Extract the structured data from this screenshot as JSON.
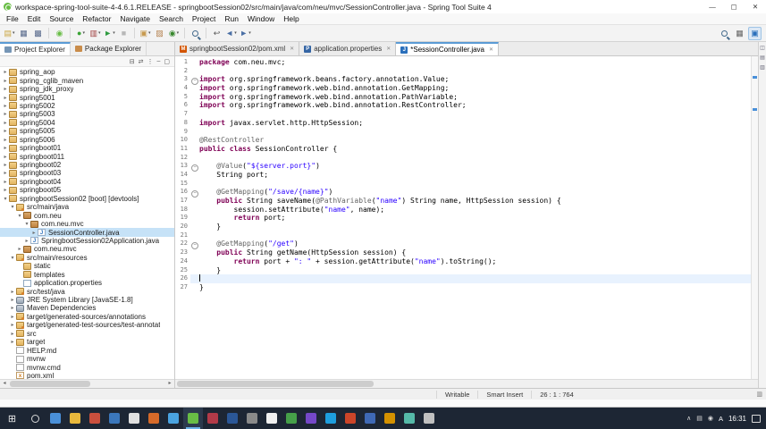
{
  "window": {
    "title": "workspace-spring-tool-suite-4-4.6.1.RELEASE - springbootSession02/src/main/java/com/neu/mvc/SessionController.java - Spring Tool Suite 4",
    "minimize": "—",
    "maximize": "▢",
    "close": "✕"
  },
  "menubar": [
    "File",
    "Edit",
    "Source",
    "Refactor",
    "Navigate",
    "Search",
    "Project",
    "Run",
    "Window",
    "Help"
  ],
  "toolbar": [
    {
      "name": "new-wizard",
      "glyph": "▤",
      "color": "#caa53f",
      "dd": true
    },
    {
      "name": "save",
      "glyph": "▦",
      "color": "#55678a"
    },
    {
      "name": "save-all",
      "glyph": "▩",
      "color": "#55678a"
    },
    {
      "sep": true
    },
    {
      "name": "boot-dashboard",
      "glyph": "◉",
      "color": "#68bd45"
    },
    {
      "sep": true
    },
    {
      "name": "debug",
      "glyph": "●",
      "color": "#3aa335",
      "dd": true
    },
    {
      "name": "coverage",
      "glyph": "▥",
      "color": "#9e3b3b",
      "dd": true
    },
    {
      "name": "run",
      "glyph": "►",
      "color": "#2e9b3f",
      "dd": true
    },
    {
      "name": "stop",
      "glyph": "■",
      "color": "#b8b8b8"
    },
    {
      "sep": true
    },
    {
      "name": "new-java-project",
      "glyph": "▣",
      "color": "#c79a4e",
      "dd": true
    },
    {
      "name": "new-package",
      "glyph": "▨",
      "color": "#b5824f"
    },
    {
      "name": "new-class",
      "glyph": "◉",
      "color": "#37872d",
      "dd": true
    },
    {
      "sep": true
    },
    {
      "name": "search",
      "lens": true
    },
    {
      "sep": true
    },
    {
      "name": "last-edit-location",
      "glyph": "↩",
      "color": "#555555"
    },
    {
      "name": "back",
      "glyph": "◄",
      "color": "#4a6fa5",
      "dd": true
    },
    {
      "name": "forward",
      "glyph": "►",
      "color": "#4a6fa5",
      "dd": true
    }
  ],
  "toolbar_right": [
    {
      "name": "quick-access-search",
      "lens": true
    },
    {
      "name": "open-perspective",
      "glyph": "▦",
      "color": "#666666"
    },
    {
      "name": "java-perspective",
      "glyph": "▣",
      "color": "#2a6fbb",
      "active": true
    }
  ],
  "explorer": {
    "tab_project": "Project Explorer",
    "tab_package": "Package Explorer",
    "toolbar": [
      {
        "name": "collapse-all",
        "glyph": "⊟"
      },
      {
        "name": "link-with-editor",
        "glyph": "⇄"
      },
      {
        "name": "view-menu",
        "glyph": "⋮"
      },
      {
        "name": "minimize-view",
        "glyph": "–"
      },
      {
        "name": "maximize-view",
        "glyph": "▢"
      }
    ],
    "tree": [
      {
        "label": "spring_aop",
        "level": 0,
        "icon": "project",
        "state": "c"
      },
      {
        "label": "spring_cglib_maven",
        "level": 0,
        "icon": "project",
        "state": "c"
      },
      {
        "label": "spring_jdk_proxy",
        "level": 0,
        "icon": "project",
        "state": "c"
      },
      {
        "label": "spring5001",
        "level": 0,
        "icon": "project",
        "state": "c"
      },
      {
        "label": "spring5002",
        "level": 0,
        "icon": "project",
        "state": "c"
      },
      {
        "label": "spring5003",
        "level": 0,
        "icon": "project",
        "state": "c"
      },
      {
        "label": "spring5004",
        "level": 0,
        "icon": "project",
        "state": "c"
      },
      {
        "label": "spring5005",
        "level": 0,
        "icon": "project",
        "state": "c"
      },
      {
        "label": "spring5006",
        "level": 0,
        "icon": "project",
        "state": "c"
      },
      {
        "label": "springboot01",
        "level": 0,
        "icon": "project",
        "state": "c"
      },
      {
        "label": "springboot011",
        "level": 0,
        "icon": "project",
        "state": "c"
      },
      {
        "label": "springboot02",
        "level": 0,
        "icon": "project",
        "state": "c"
      },
      {
        "label": "springboot03",
        "level": 0,
        "icon": "project",
        "state": "c"
      },
      {
        "label": "springboot04",
        "level": 0,
        "icon": "project",
        "state": "c"
      },
      {
        "label": "springboot05",
        "level": 0,
        "icon": "project",
        "state": "c"
      },
      {
        "label": "springbootSession02 [boot] [devtools]",
        "level": 0,
        "icon": "project",
        "state": "e"
      },
      {
        "label": "src/main/java",
        "level": 1,
        "icon": "srcfolder",
        "state": "e"
      },
      {
        "label": "com.neu",
        "level": 2,
        "icon": "package",
        "state": "e"
      },
      {
        "label": "com.neu.mvc",
        "level": 3,
        "icon": "package",
        "state": "e"
      },
      {
        "label": "SessionController.java",
        "level": 4,
        "icon": "java",
        "state": "c",
        "selected": true
      },
      {
        "label": "SpringbootSession02Application.java",
        "level": 3,
        "icon": "java",
        "state": "c"
      },
      {
        "label": "com.neu.mvc",
        "level": 2,
        "icon": "package",
        "state": "c"
      },
      {
        "label": "src/main/resources",
        "level": 1,
        "icon": "srcfolder",
        "state": "e"
      },
      {
        "label": "static",
        "level": 2,
        "icon": "folder",
        "state": "n"
      },
      {
        "label": "templates",
        "level": 2,
        "icon": "folder",
        "state": "n"
      },
      {
        "label": "application.properties",
        "level": 2,
        "icon": "props",
        "state": "n"
      },
      {
        "label": "src/test/java",
        "level": 1,
        "icon": "srcfolder",
        "state": "c"
      },
      {
        "label": "JRE System Library [JavaSE-1.8]",
        "level": 1,
        "icon": "lib",
        "state": "c"
      },
      {
        "label": "Maven Dependencies",
        "level": 1,
        "icon": "lib",
        "state": "c"
      },
      {
        "label": "target/generated-sources/annotations",
        "level": 1,
        "icon": "srcfolder",
        "state": "c"
      },
      {
        "label": "target/generated-test-sources/test-annotat",
        "level": 1,
        "icon": "srcfolder",
        "state": "c"
      },
      {
        "label": "src",
        "level": 1,
        "icon": "folder",
        "state": "c"
      },
      {
        "label": "target",
        "level": 1,
        "icon": "folder",
        "state": "c"
      },
      {
        "label": "HELP.md",
        "level": 1,
        "icon": "file",
        "state": "n"
      },
      {
        "label": "mvnw",
        "level": 1,
        "icon": "file",
        "state": "n"
      },
      {
        "label": "mvnw.cmd",
        "level": 1,
        "icon": "file",
        "state": "n"
      },
      {
        "label": "pom.xml",
        "level": 1,
        "icon": "xml",
        "state": "n"
      }
    ]
  },
  "editor": {
    "tabs": [
      {
        "label": "springbootSession02/pom.xml",
        "icon_letter": "M",
        "icon_color": "#d35400",
        "active": false
      },
      {
        "label": "application.properties",
        "icon_letter": "P",
        "icon_color": "#3465a4",
        "active": false
      },
      {
        "label": "*SessionController.java",
        "icon_letter": "J",
        "icon_color": "#2a6fbb",
        "active": true
      }
    ],
    "code": {
      "current_line": 26,
      "folds": [
        3,
        13,
        16,
        22
      ],
      "lines": [
        [
          [
            "k",
            "package"
          ],
          [
            "p",
            " com.neu.mvc;"
          ]
        ],
        [],
        [
          [
            "k",
            "import"
          ],
          [
            "p",
            " org.springframework.beans.factory.annotation.Value;"
          ]
        ],
        [
          [
            "k",
            "import"
          ],
          [
            "p",
            " org.springframework.web.bind.annotation.GetMapping;"
          ]
        ],
        [
          [
            "k",
            "import"
          ],
          [
            "p",
            " org.springframework.web.bind.annotation.PathVariable;"
          ]
        ],
        [
          [
            "k",
            "import"
          ],
          [
            "p",
            " org.springframework.web.bind.annotation.RestController;"
          ]
        ],
        [],
        [
          [
            "k",
            "import"
          ],
          [
            "p",
            " javax.servlet.http.HttpSession;"
          ]
        ],
        [],
        [
          [
            "a",
            "@RestController"
          ]
        ],
        [
          [
            "k",
            "public"
          ],
          [
            "p",
            " "
          ],
          [
            "k",
            "class"
          ],
          [
            "p",
            " SessionController {"
          ]
        ],
        [],
        [
          [
            "p",
            "    "
          ],
          [
            "a",
            "@Value"
          ],
          [
            "p",
            "("
          ],
          [
            "s",
            "\"${server.port}\""
          ],
          [
            "p",
            ")"
          ]
        ],
        [
          [
            "p",
            "    String port;"
          ]
        ],
        [],
        [
          [
            "p",
            "    "
          ],
          [
            "a",
            "@GetMapping"
          ],
          [
            "p",
            "("
          ],
          [
            "s",
            "\"/save/{name}\""
          ],
          [
            "p",
            ")"
          ]
        ],
        [
          [
            "p",
            "    "
          ],
          [
            "k",
            "public"
          ],
          [
            "p",
            " String saveName("
          ],
          [
            "a",
            "@PathVariable"
          ],
          [
            "p",
            "("
          ],
          [
            "s",
            "\"name\""
          ],
          [
            "p",
            ") String name, HttpSession session) {"
          ]
        ],
        [
          [
            "p",
            "        session.setAttribute("
          ],
          [
            "s",
            "\"name\""
          ],
          [
            "p",
            ", name);"
          ]
        ],
        [
          [
            "p",
            "        "
          ],
          [
            "k",
            "return"
          ],
          [
            "p",
            " port;"
          ]
        ],
        [
          [
            "p",
            "    }"
          ]
        ],
        [],
        [
          [
            "p",
            "    "
          ],
          [
            "a",
            "@GetMapping"
          ],
          [
            "p",
            "("
          ],
          [
            "s",
            "\"/get\""
          ],
          [
            "p",
            ")"
          ]
        ],
        [
          [
            "p",
            "    "
          ],
          [
            "k",
            "public"
          ],
          [
            "p",
            " String getName(HttpSession session) {"
          ]
        ],
        [
          [
            "p",
            "        "
          ],
          [
            "k",
            "return"
          ],
          [
            "p",
            " port + "
          ],
          [
            "s",
            "\": \""
          ],
          [
            "p",
            " + session.getAttribute("
          ],
          [
            "s",
            "\"name\""
          ],
          [
            "p",
            ").toString();"
          ]
        ],
        [
          [
            "p",
            "    }"
          ]
        ],
        [],
        [
          [
            "p",
            "}"
          ]
        ]
      ]
    }
  },
  "side_strip": [
    {
      "name": "restore-panes",
      "glyph": "◫"
    },
    {
      "name": "outline-view",
      "glyph": "▤"
    },
    {
      "name": "tasks-view",
      "glyph": "▥"
    }
  ],
  "status": {
    "writable": "Writable",
    "insert_mode": "Smart Insert",
    "position": "26 : 1 : 764"
  },
  "taskbar": {
    "start_glyph": "⊞",
    "time": "16:31",
    "ime": "A",
    "tray": [
      {
        "name": "hidden-icons-chevron",
        "glyph": "∧"
      },
      {
        "name": "system-tray-icon-1",
        "glyph": "▤"
      },
      {
        "name": "system-tray-icon-2",
        "glyph": "◉"
      }
    ],
    "apps": [
      {
        "color": "#4a90d9"
      },
      {
        "color": "#e8b83c"
      },
      {
        "color": "#c94f3d"
      },
      {
        "color": "#3b77bc"
      },
      {
        "color": "#e0e0e0"
      },
      {
        "color": "#d66a29"
      },
      {
        "color": "#4aa3e0"
      },
      {
        "color": "#68bd45",
        "active": true
      },
      {
        "color": "#b23a48"
      },
      {
        "color": "#2b5797"
      },
      {
        "color": "#8a8a8a"
      },
      {
        "color": "#f0f0f0"
      },
      {
        "color": "#46a049"
      },
      {
        "color": "#7548c8"
      },
      {
        "color": "#1e9ede"
      },
      {
        "color": "#cc4529"
      },
      {
        "color": "#3f69b5"
      },
      {
        "color": "#d49100"
      },
      {
        "color": "#55b9a8"
      },
      {
        "color": "#c0c0c0"
      }
    ]
  },
  "colors": {
    "keyword": "#7f0055",
    "string": "#2a00ff",
    "annotation": "#646464",
    "current_line": "#e8f2fe",
    "tree_selection": "#c6e2f7",
    "taskbar_bg": "#1d2634",
    "accent_tab": "#5a9bd5"
  }
}
